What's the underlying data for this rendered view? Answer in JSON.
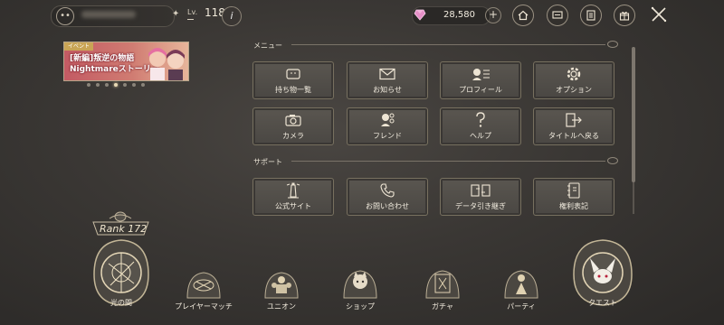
{
  "player": {
    "level_label": "Lv.",
    "level": "118"
  },
  "currency": {
    "gems": "28,580"
  },
  "top_buttons": [
    {
      "name": "home-button",
      "icon": "home-icon"
    },
    {
      "name": "chat-button",
      "icon": "chat-icon"
    },
    {
      "name": "mission-button",
      "icon": "list-icon"
    },
    {
      "name": "present-button",
      "icon": "gift-icon"
    }
  ],
  "banner": {
    "tag": "イベント",
    "line1": "[新編]叛逆の物語",
    "line2": "Nightmareストーリー"
  },
  "menu": {
    "title": "メニュー",
    "items": [
      {
        "label": "持ち物一覧",
        "icon": "inventory-icon"
      },
      {
        "label": "お知らせ",
        "icon": "mail-icon"
      },
      {
        "label": "プロフィール",
        "icon": "profile-icon"
      },
      {
        "label": "オプション",
        "icon": "gear-icon"
      },
      {
        "label": "カメラ",
        "icon": "camera-icon"
      },
      {
        "label": "フレンド",
        "icon": "friend-icon"
      },
      {
        "label": "ヘルプ",
        "icon": "question-icon"
      },
      {
        "label": "タイトルへ戻る",
        "icon": "exit-icon"
      }
    ]
  },
  "support": {
    "title": "サポート",
    "items": [
      {
        "label": "公式サイト",
        "icon": "lighthouse-icon"
      },
      {
        "label": "お問い合わせ",
        "icon": "phone-icon"
      },
      {
        "label": "データ引き継ぎ",
        "icon": "transfer-icon"
      },
      {
        "label": "権利表記",
        "icon": "notebook-icon"
      }
    ]
  },
  "rank": {
    "text": "Rank 172"
  },
  "bottom_nav": [
    {
      "label": "光の間"
    },
    {
      "label": "プレイヤーマッチ"
    },
    {
      "label": "ユニオン"
    },
    {
      "label": "ショップ"
    },
    {
      "label": "ガチャ"
    },
    {
      "label": "パーティ"
    },
    {
      "label": "クエスト"
    }
  ]
}
